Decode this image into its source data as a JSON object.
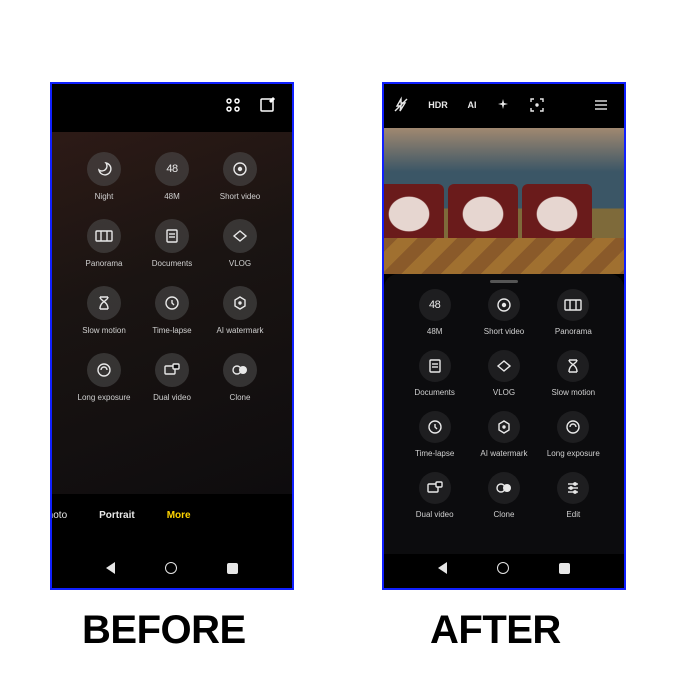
{
  "labels": {
    "before": "BEFORE",
    "after": "AFTER"
  },
  "before": {
    "topbar": {
      "menu_icon": "grid-menu",
      "edit_icon": "edit"
    },
    "modes": [
      {
        "icon": "moon",
        "label": "Night"
      },
      {
        "icon": "48",
        "label": "48M"
      },
      {
        "icon": "record",
        "label": "Short video"
      },
      {
        "icon": "pano",
        "label": "Panorama"
      },
      {
        "icon": "doc",
        "label": "Documents"
      },
      {
        "icon": "heart",
        "label": "VLOG"
      },
      {
        "icon": "hourglass",
        "label": "Slow motion"
      },
      {
        "icon": "clock",
        "label": "Time-lapse"
      },
      {
        "icon": "hex",
        "label": "AI watermark"
      },
      {
        "icon": "long",
        "label": "Long exposure"
      },
      {
        "icon": "dual",
        "label": "Dual video"
      },
      {
        "icon": "clone",
        "label": "Clone"
      }
    ],
    "tabs": {
      "photo": "Photo",
      "portrait": "Portrait",
      "more": "More"
    }
  },
  "after": {
    "topbar": [
      {
        "icon": "flash-off"
      },
      {
        "text": "HDR"
      },
      {
        "text": "AI"
      },
      {
        "icon": "sparkle"
      },
      {
        "icon": "focus-square"
      },
      {
        "icon": "hamburger"
      }
    ],
    "modes": [
      {
        "icon": "48",
        "label": "48M"
      },
      {
        "icon": "record",
        "label": "Short video"
      },
      {
        "icon": "pano",
        "label": "Panorama"
      },
      {
        "icon": "doc",
        "label": "Documents"
      },
      {
        "icon": "heart",
        "label": "VLOG"
      },
      {
        "icon": "hourglass",
        "label": "Slow motion"
      },
      {
        "icon": "clock",
        "label": "Time-lapse"
      },
      {
        "icon": "hex",
        "label": "AI watermark"
      },
      {
        "icon": "long",
        "label": "Long exposure"
      },
      {
        "icon": "dual",
        "label": "Dual video"
      },
      {
        "icon": "clone",
        "label": "Clone"
      },
      {
        "icon": "edit-lines",
        "label": "Edit"
      }
    ]
  }
}
